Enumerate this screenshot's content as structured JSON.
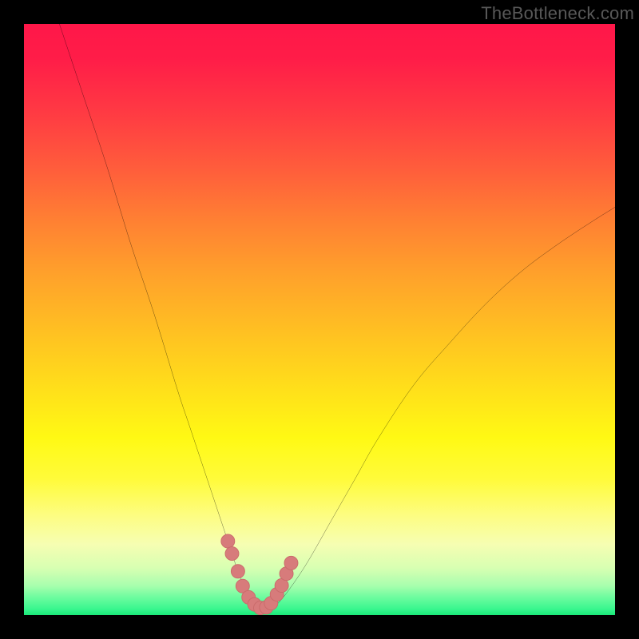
{
  "watermark": "TheBottleneck.com",
  "colors": {
    "frame": "#000000",
    "curve": "#000000",
    "markerFill": "#d77b7b",
    "markerStroke": "#c96a6a"
  },
  "chart_data": {
    "type": "line",
    "title": "",
    "xlabel": "",
    "ylabel": "",
    "xlim": [
      0,
      100
    ],
    "ylim": [
      0,
      100
    ],
    "curve": {
      "x": [
        6,
        10,
        14,
        18,
        22,
        26,
        28,
        30,
        32,
        34,
        35,
        36,
        37,
        38,
        39,
        40,
        41,
        42,
        43,
        45,
        48,
        52,
        56,
        60,
        66,
        72,
        78,
        84,
        90,
        96,
        100
      ],
      "values": [
        100,
        88,
        76,
        63,
        51,
        38,
        32,
        26,
        20,
        14,
        11,
        8,
        5.5,
        3.5,
        2,
        1.2,
        1,
        1.2,
        2,
        4.5,
        9,
        16,
        23,
        30,
        39,
        46,
        52.5,
        58,
        62.5,
        66.5,
        69
      ]
    },
    "markers": {
      "x": [
        34.5,
        35.2,
        36.2,
        37.0,
        38.0,
        39.0,
        40.0,
        41.0,
        41.8,
        42.8,
        43.6,
        44.4,
        45.2
      ],
      "values": [
        12.5,
        10.4,
        7.4,
        4.9,
        3.0,
        1.8,
        1.2,
        1.3,
        2.0,
        3.5,
        5.0,
        7.0,
        8.8
      ]
    }
  }
}
